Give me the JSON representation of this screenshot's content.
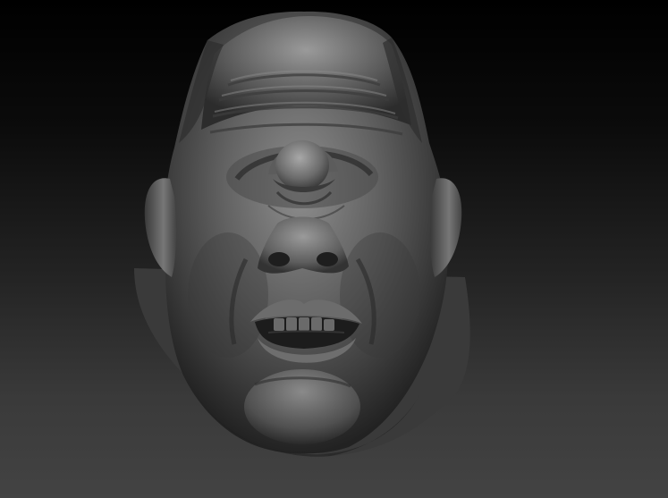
{
  "scene": {
    "description_icon": "sculpted-cyclops-head",
    "colors": {
      "background_top": "#000000",
      "background_bottom": "#434343",
      "clay_light": "#9a9a9a",
      "clay_mid": "#5e5e5e",
      "clay_dark": "#2a2a2a"
    }
  }
}
